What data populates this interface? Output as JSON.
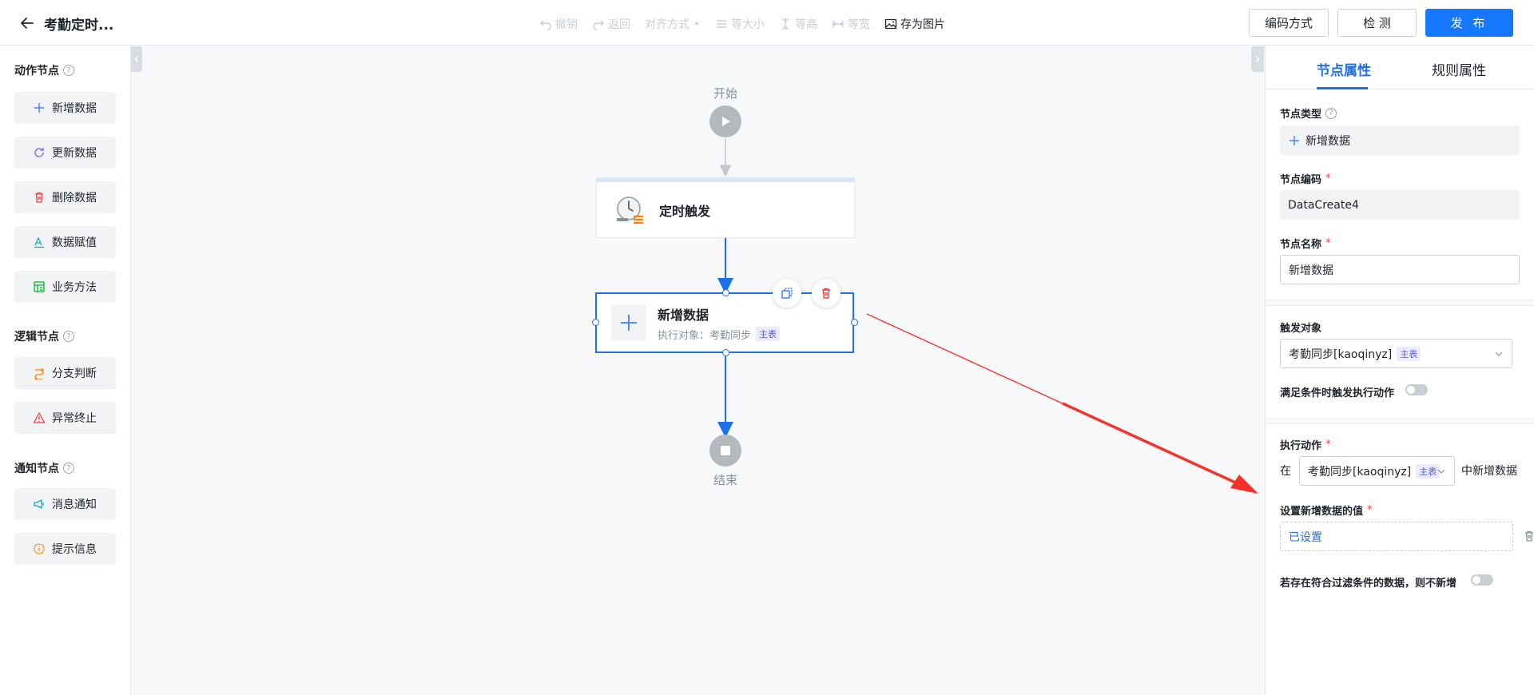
{
  "header": {
    "title": "考勤定时...",
    "toolbar": {
      "undo": "撤销",
      "redo": "返回",
      "align": "对齐方式",
      "same_size": "等大小",
      "same_height": "等高",
      "same_width": "等宽",
      "save_image": "存为图片"
    },
    "buttons": {
      "encoding": "编码方式",
      "detect": "检 测",
      "publish": "发 布"
    }
  },
  "sidebar": {
    "sections": [
      {
        "title": "动作节点",
        "items": [
          "新增数据",
          "更新数据",
          "删除数据",
          "数据赋值",
          "业务方法"
        ]
      },
      {
        "title": "逻辑节点",
        "items": [
          "分支判断",
          "异常终止"
        ]
      },
      {
        "title": "通知节点",
        "items": [
          "消息通知",
          "提示信息"
        ]
      }
    ]
  },
  "canvas": {
    "start_label": "开始",
    "end_label": "结束",
    "trigger_node": {
      "title": "定时触发"
    },
    "action_node": {
      "title": "新增数据",
      "subtitle": "执行对象：考勤同步",
      "tag": "主表"
    }
  },
  "panel": {
    "tabs": [
      "节点属性",
      "规则属性"
    ],
    "node_type": {
      "label": "节点类型",
      "value": "新增数据"
    },
    "node_code": {
      "label": "节点编码",
      "value": "DataCreate4"
    },
    "node_name": {
      "label": "节点名称",
      "value": "新增数据"
    },
    "trigger_object": {
      "label": "触发对象",
      "value": "考勤同步[kaoqinyz]",
      "tag": "主表"
    },
    "trigger_condition": {
      "label": "满足条件时触发执行动作"
    },
    "action": {
      "label": "执行动作",
      "prefix": "在",
      "value": "考勤同步[kaoqinyz]",
      "tag": "主表",
      "suffix": "中新增数据"
    },
    "set_values": {
      "label": "设置新增数据的值",
      "value": "已设置"
    },
    "skip_existing": {
      "label": "若存在符合过滤条件的数据，则不新增"
    },
    "required_mark": "*"
  },
  "colors": {
    "primary": "#1677ff",
    "node_border": "#1f6fe8",
    "annotation_arrow": "#f5322b"
  }
}
